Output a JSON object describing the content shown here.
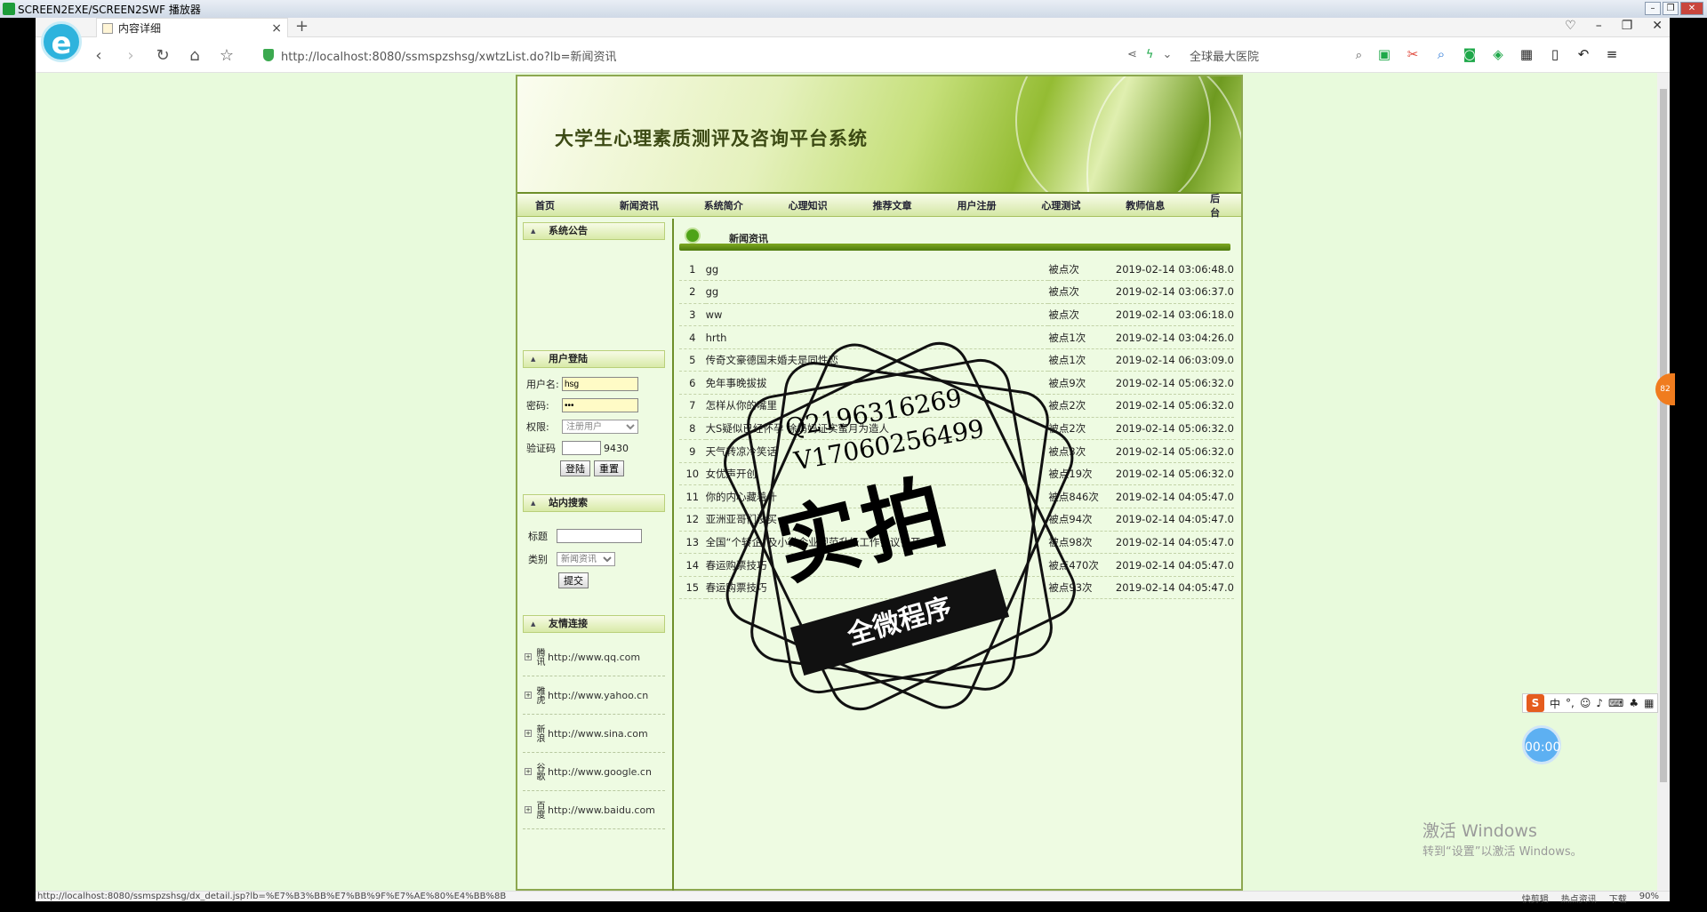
{
  "recorder": {
    "title": "SCREEN2EXE/SCREEN2SWF 播放器"
  },
  "browser": {
    "tab_title": "内容详细",
    "url": "http://localhost:8080/ssmspzshsg/xwtzList.do?lb=新闻资讯",
    "search_placeholder": "全球最大医院",
    "status_url": "http://localhost:8080/ssmspzshsg/dx_detail.jsp?lb=%E7%B3%BB%E7%BB%9F%E7%AE%80%E4%BB%8B",
    "status_items": [
      "快剪辑",
      "热点资讯",
      "下载",
      "90%"
    ],
    "zoom": "90%"
  },
  "site": {
    "title": "大学生心理素质测评及咨询平台系统",
    "menu": [
      "首页",
      "新闻资讯",
      "系统简介",
      "心理知识",
      "推荐文章",
      "用户注册",
      "心理测试",
      "教师信息",
      "后台"
    ]
  },
  "sidebar": {
    "notice_title": "系统公告",
    "login": {
      "title": "用户登陆",
      "username_label": "用户名:",
      "username_value": "hsg",
      "password_label": "密码:",
      "password_value": "•••",
      "role_label": "权限:",
      "role_value": "注册用户",
      "captcha_label": "验证码",
      "captcha_code": "9430",
      "login_btn": "登陆",
      "reset_btn": "重置"
    },
    "search": {
      "title": "站内搜索",
      "title_label": "标题",
      "category_label": "类别",
      "category_value": "新闻资讯",
      "submit_btn": "提交"
    },
    "links": {
      "title": "友情连接",
      "items": [
        {
          "name": "腾讯",
          "url": "http://www.qq.com"
        },
        {
          "name": "雅虎",
          "url": "http://www.yahoo.cn"
        },
        {
          "name": "新浪",
          "url": "http://www.sina.com"
        },
        {
          "name": "谷歌",
          "url": "http://www.google.cn"
        },
        {
          "name": "百度",
          "url": "http://www.baidu.com"
        }
      ]
    }
  },
  "main": {
    "title": "新闻资讯",
    "rows": [
      {
        "no": "1",
        "title": "gg",
        "clicks": "被点次",
        "date": "2019-02-14 03:06:48.0"
      },
      {
        "no": "2",
        "title": "gg",
        "clicks": "被点次",
        "date": "2019-02-14 03:06:37.0"
      },
      {
        "no": "3",
        "title": "ww",
        "clicks": "被点次",
        "date": "2019-02-14 03:06:18.0"
      },
      {
        "no": "4",
        "title": "hrth",
        "clicks": "被点1次",
        "date": "2019-02-14 03:04:26.0"
      },
      {
        "no": "5",
        "title": "传奇文豪德国未婚夫是同性恋",
        "clicks": "被点1次",
        "date": "2019-02-14 06:03:09.0"
      },
      {
        "no": "6",
        "title": "免年事晚拔拔",
        "clicks": "被点9次",
        "date": "2019-02-14 05:06:32.0"
      },
      {
        "no": "7",
        "title": "怎样从你的嘴里",
        "clicks": "被点2次",
        "date": "2019-02-14 05:06:32.0"
      },
      {
        "no": "8",
        "title": "大S疑似已经怀孕 徐妈妈证实蜜月为造人",
        "clicks": "被点2次",
        "date": "2019-02-14 05:06:32.0"
      },
      {
        "no": "9",
        "title": "天气转凉冷笑话",
        "clicks": "被点3次",
        "date": "2019-02-14 05:06:32.0"
      },
      {
        "no": "10",
        "title": "女优声开创",
        "clicks": "被点19次",
        "date": "2019-02-14 05:06:32.0"
      },
      {
        "no": "11",
        "title": "你的内心藏着什",
        "clicks": "被点846次",
        "date": "2019-02-14 04:05:47.0"
      },
      {
        "no": "12",
        "title": "亚洲亚哥们没买",
        "clicks": "被点94次",
        "date": "2019-02-14 04:05:47.0"
      },
      {
        "no": "13",
        "title": "全国“个转企”及小微企业规范升级工作会议召开",
        "clicks": "被点98次",
        "date": "2019-02-14 04:05:47.0"
      },
      {
        "no": "14",
        "title": "春运购票技巧",
        "clicks": "被点470次",
        "date": "2019-02-14 04:05:47.0"
      },
      {
        "no": "15",
        "title": "春运购票技巧",
        "clicks": "被点93次",
        "date": "2019-02-14 04:05:47.0"
      }
    ]
  },
  "watermark": {
    "qq": "Q2196316269",
    "vx": "V17060256499",
    "big": "实拍",
    "ribbon": "全微程序"
  },
  "os": {
    "activate_title": "激活 Windows",
    "activate_sub": "转到“设置”以激活 Windows。",
    "timer": "00:00",
    "ime_lang": "中",
    "side_badge": "82"
  },
  "colors": {
    "page_bg": "#e8fadc",
    "accent": "#6e8f2a",
    "nav_text": "#223"
  }
}
